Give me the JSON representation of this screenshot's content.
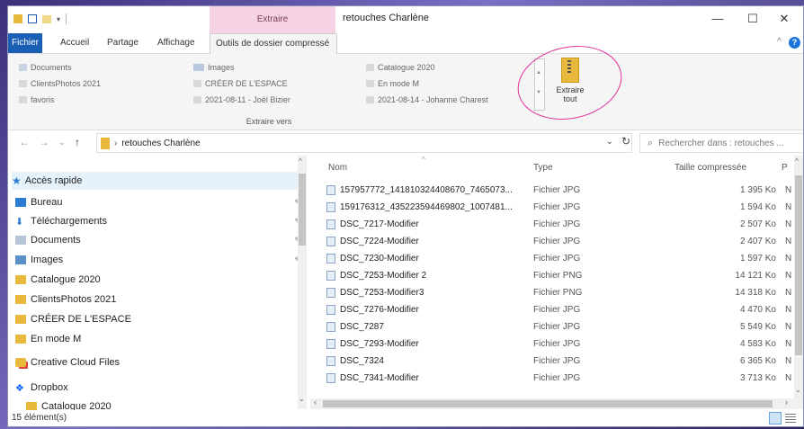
{
  "window": {
    "title": "retouches Charlène",
    "context_tab": "Extraire",
    "minimize": "—",
    "maximize": "☐",
    "close": "✕"
  },
  "ribbon_tabs": [
    {
      "label": "Fichier"
    },
    {
      "label": "Accueil"
    },
    {
      "label": "Partage"
    },
    {
      "label": "Affichage"
    },
    {
      "label": "Outils de dossier compressé"
    }
  ],
  "ribbon": {
    "destinations": [
      {
        "label": "Documents"
      },
      {
        "label": "ClientsPhotos 2021"
      },
      {
        "label": "favoris"
      },
      {
        "label": "Images"
      },
      {
        "label": "CRÉER DE L'ESPACE"
      },
      {
        "label": "2021-08-11 - Joël Bizier"
      },
      {
        "label": "Catalogue 2020"
      },
      {
        "label": "En mode M"
      },
      {
        "label": "2021-08-14 - Johanne Charest"
      }
    ],
    "group_label": "Extraire vers",
    "extract_all_line1": "Extraire",
    "extract_all_line2": "tout"
  },
  "addressbar": {
    "path": "retouches Charlène",
    "search_placeholder": "Rechercher dans : retouches ..."
  },
  "sidebar": {
    "quick_access": "Accès rapide",
    "items": [
      {
        "label": "Bureau",
        "pinned": true
      },
      {
        "label": "Téléchargements",
        "pinned": true
      },
      {
        "label": "Documents",
        "pinned": true
      },
      {
        "label": "Images",
        "pinned": true
      },
      {
        "label": "Catalogue 2020"
      },
      {
        "label": "ClientsPhotos 2021"
      },
      {
        "label": "CRÉER DE L'ESPACE"
      },
      {
        "label": "En mode M"
      }
    ],
    "creative_cloud": "Creative Cloud Files",
    "dropbox": "Dropbox",
    "dropbox_child": "Catalogue 2020"
  },
  "columns": {
    "name": "Nom",
    "type": "Type",
    "size": "Taille compressée",
    "extra": "P"
  },
  "files": [
    {
      "name": "157957772_141810324408670_7465073...",
      "type": "Fichier JPG",
      "size": "1 395 Ko",
      "extra": "N"
    },
    {
      "name": "159176312_435223594469802_1007481...",
      "type": "Fichier JPG",
      "size": "1 594 Ko",
      "extra": "N"
    },
    {
      "name": "DSC_7217-Modifier",
      "type": "Fichier JPG",
      "size": "2 507 Ko",
      "extra": "N"
    },
    {
      "name": "DSC_7224-Modifier",
      "type": "Fichier JPG",
      "size": "2 407 Ko",
      "extra": "N"
    },
    {
      "name": "DSC_7230-Modifier",
      "type": "Fichier JPG",
      "size": "1 597 Ko",
      "extra": "N"
    },
    {
      "name": "DSC_7253-Modifier 2",
      "type": "Fichier PNG",
      "size": "14 121 Ko",
      "extra": "N"
    },
    {
      "name": "DSC_7253-Modifier3",
      "type": "Fichier PNG",
      "size": "14 318 Ko",
      "extra": "N"
    },
    {
      "name": "DSC_7276-Modifier",
      "type": "Fichier JPG",
      "size": "4 470 Ko",
      "extra": "N"
    },
    {
      "name": "DSC_7287",
      "type": "Fichier JPG",
      "size": "5 549 Ko",
      "extra": "N"
    },
    {
      "name": "DSC_7293-Modifier",
      "type": "Fichier JPG",
      "size": "4 583 Ko",
      "extra": "N"
    },
    {
      "name": "DSC_7324",
      "type": "Fichier JPG",
      "size": "6 365 Ko",
      "extra": "N"
    },
    {
      "name": "DSC_7341-Modifier",
      "type": "Fichier JPG",
      "size": "3 713 Ko",
      "extra": "N"
    }
  ],
  "status": {
    "count": "15 élément(s)"
  },
  "colors": {
    "fichier_tab": "#1a5fb4",
    "context_tab_bg": "#f6d3e4",
    "annotation_circle": "#e0309a",
    "folder": "#e8b93c",
    "quick_access_star": "#2b7cd3"
  }
}
